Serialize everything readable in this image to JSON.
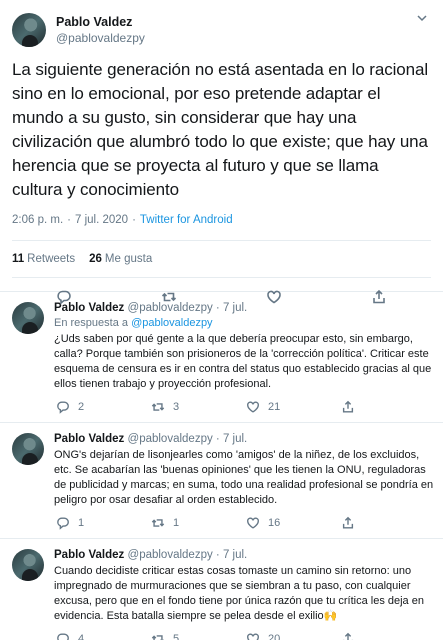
{
  "main_tweet": {
    "author_name": "Pablo Valdez",
    "author_handle": "@pablovaldezpy",
    "text": "La siguiente generación no está asentada en lo racional sino en lo emocional, por eso pretende adaptar el mundo a su gusto, sin considerar que hay una civilización que alumbró todo lo que existe; que hay una herencia que se proyecta al futuro y que se llama cultura y conocimiento",
    "time": "2:06 p. m.",
    "date": "7 jul. 2020",
    "dot": "·",
    "source": "Twitter for Android",
    "retweets_count": "11",
    "retweets_label": "Retweets",
    "likes_count": "26",
    "likes_label": "Me gusta"
  },
  "replies": [
    {
      "author_name": "Pablo Valdez",
      "author_handle": "@pablovaldezpy",
      "date": "· 7 jul.",
      "reply_to_prefix": "En respuesta a",
      "reply_to_handle": "@pablovaldezpy",
      "text": "¿Uds saben por qué gente a la que debería preocupar esto, sin embargo, calla? Porque también son prisioneros de la 'corrección política'. Criticar este esquema de censura es ir en contra del status quo establecido gracias al que ellos tienen trabajo y proyección profesional.",
      "replies": "2",
      "retweets": "3",
      "likes": "21"
    },
    {
      "author_name": "Pablo Valdez",
      "author_handle": "@pablovaldezpy",
      "date": "· 7 jul.",
      "text": "ONG's dejarían de lisonjearles como 'amigos' de la niñez, de los excluidos, etc. Se acabarían las 'buenas opiniones' que les tienen la ONU, reguladoras de publicidad y marcas; en suma, todo una realidad profesional se pondría en peligro por osar desafiar al orden establecido.",
      "replies": "1",
      "retweets": "1",
      "likes": "16"
    },
    {
      "author_name": "Pablo Valdez",
      "author_handle": "@pablovaldezpy",
      "date": "· 7 jul.",
      "text": "Cuando decidiste criticar estas cosas tomaste un camino sin retorno: uno impregnado de murmuraciones que se siembran a tu paso, con cualquier excusa, pero que en el fondo tiene por única razón que tu crítica les deja en evidencia. Esta batalla siempre se pelea desde el exilio🙌",
      "replies": "4",
      "retweets": "5",
      "likes": "20"
    }
  ],
  "icons": {
    "reply": "reply-icon",
    "retweet": "retweet-icon",
    "like": "heart-icon",
    "share": "share-icon",
    "more": "chevron-down-icon"
  },
  "colors": {
    "accent": "#1b95e0",
    "muted": "#657786",
    "text": "#14171a",
    "border": "#e6ecf0"
  }
}
